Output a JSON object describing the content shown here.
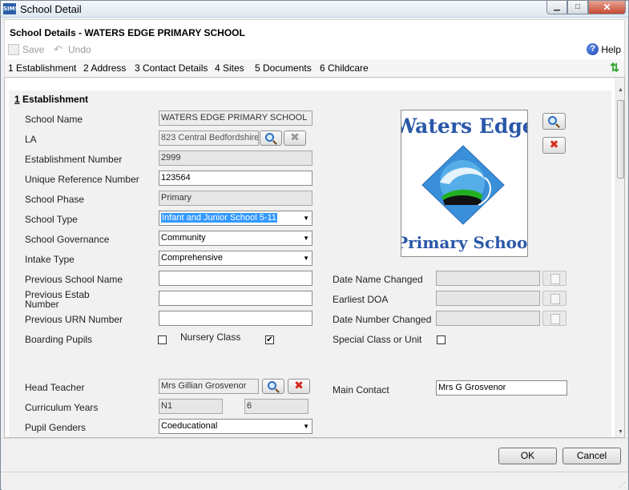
{
  "window": {
    "app_icon_text": "SIMS",
    "title": "School Detail",
    "minimize_glyph": "▁",
    "maximize_glyph": "□",
    "close_glyph": "✕"
  },
  "header": {
    "title": "School Details - WATERS EDGE PRIMARY SCHOOL"
  },
  "toolbar": {
    "save_label": "Save",
    "undo_label": "Undo",
    "help_label": "Help",
    "help_glyph": "?"
  },
  "tabs": [
    {
      "label": "1 Establishment"
    },
    {
      "label": "2 Address"
    },
    {
      "label": "3 Contact Details"
    },
    {
      "label": "4 Sites"
    },
    {
      "label": "5 Documents"
    },
    {
      "label": "6 Childcare"
    }
  ],
  "section": {
    "number": "1",
    "title": "Establishment"
  },
  "fields": {
    "school_name": {
      "label": "School Name",
      "value": "WATERS EDGE PRIMARY SCHOOL"
    },
    "la": {
      "label": "LA",
      "value": "823 Central Bedfordshire"
    },
    "establishment_number": {
      "label": "Establishment Number",
      "value": "2999"
    },
    "urn": {
      "label": "Unique Reference Number",
      "value": "123564"
    },
    "school_phase": {
      "label": "School Phase",
      "value": "Primary"
    },
    "school_type": {
      "label": "School Type",
      "value": "Infant and Junior School 5-11"
    },
    "school_governance": {
      "label": "School Governance",
      "value": "Community"
    },
    "intake_type": {
      "label": "Intake Type",
      "value": "Comprehensive"
    },
    "previous_school_name": {
      "label": "Previous School Name",
      "value": ""
    },
    "previous_estab_number": {
      "label_line1": "Previous Estab",
      "label_line2": "Number",
      "value": ""
    },
    "previous_urn": {
      "label": "Previous URN Number",
      "value": ""
    },
    "boarding_pupils": {
      "label": "Boarding Pupils",
      "checked": false
    },
    "nursery_class": {
      "label": "Nursery Class",
      "checked": true
    },
    "date_name_changed": {
      "label": "Date Name Changed",
      "value": ""
    },
    "earliest_doa": {
      "label": "Earliest DOA",
      "value": ""
    },
    "date_number_changed": {
      "label": "Date Number Changed",
      "value": ""
    },
    "special_class": {
      "label": "Special Class or Unit",
      "checked": false
    },
    "head_teacher": {
      "label": "Head Teacher",
      "value": "Mrs Gillian Grosvenor"
    },
    "main_contact": {
      "label": "Main Contact",
      "value": "Mrs G Grosvenor"
    },
    "curriculum_years": {
      "label": "Curriculum Years",
      "from": "N1",
      "to": "6"
    },
    "pupil_genders": {
      "label": "Pupil Genders",
      "value": "Coeducational"
    }
  },
  "logo": {
    "line1": "Waters Edge",
    "line2": "Primary School"
  },
  "icons": {
    "check_glyph": "✔",
    "x_glyph": "✖",
    "dropdown_glyph": "▼",
    "scroll_up_glyph": "▲",
    "scroll_down_glyph": "▼",
    "swap_glyph": "⇅"
  },
  "footer": {
    "ok_label": "OK",
    "cancel_label": "Cancel"
  }
}
